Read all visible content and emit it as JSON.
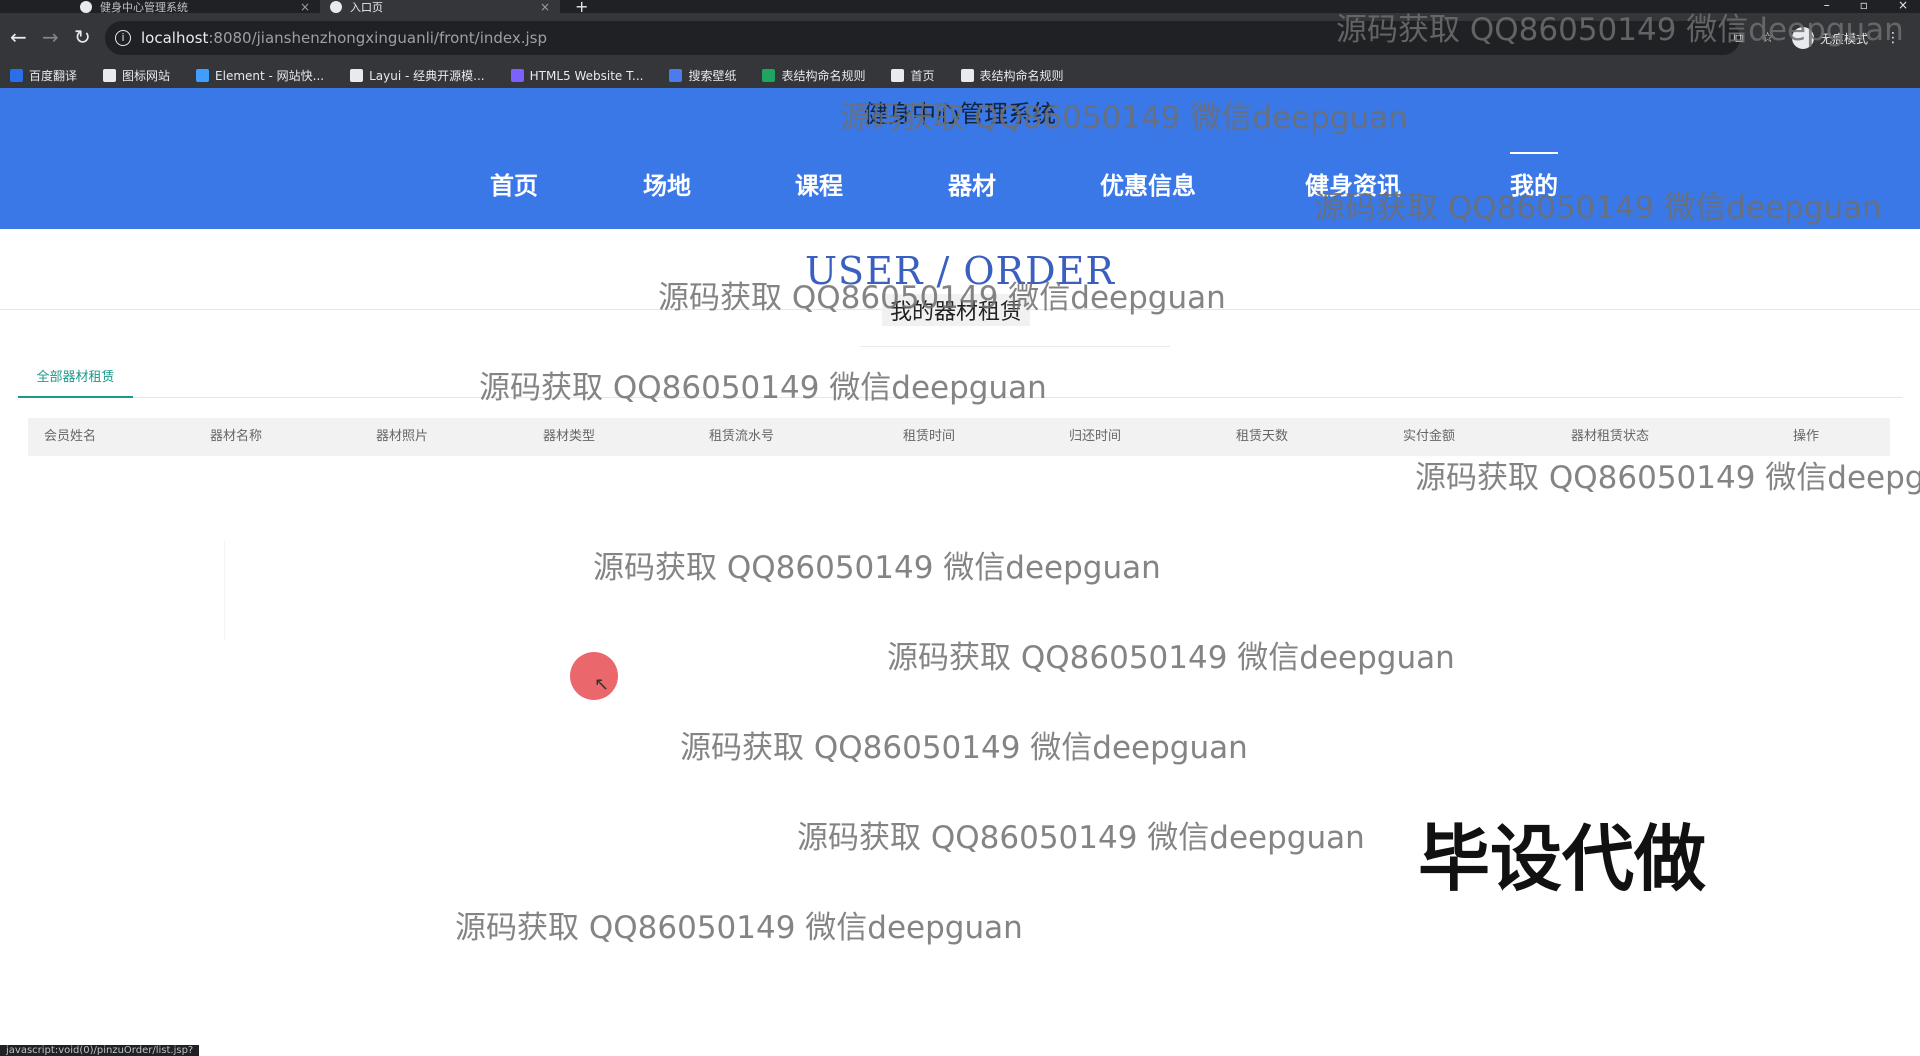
{
  "browser": {
    "tabs": [
      {
        "label": "健身中心管理系统"
      },
      {
        "label": "入口页"
      }
    ],
    "url": {
      "host": "localhost",
      "path": ":8080/jianshenzhongxinguanli/front/index.jsp"
    },
    "mode_label": "无痕模式",
    "bookmarks": [
      {
        "label": "百度翻译",
        "color": "#2a6fe8"
      },
      {
        "label": "图标网站",
        "color": "#e8eaed"
      },
      {
        "label": "Element - 网站快...",
        "color": "#409eff"
      },
      {
        "label": "Layui - 经典开源模...",
        "color": "#e8eaed"
      },
      {
        "label": "HTML5 Website T...",
        "color": "#7b61ff"
      },
      {
        "label": "搜索壁纸",
        "color": "#4a7cf0"
      },
      {
        "label": "表结构命名规则",
        "color": "#1fa463"
      },
      {
        "label": "首页",
        "color": "#e8eaed"
      },
      {
        "label": "表结构命名规则",
        "color": "#e8eaed"
      }
    ],
    "status_text": "javascript:void(0)/pinzuOrder/list.jsp?"
  },
  "site": {
    "title": "健身中心管理系统",
    "nav": [
      {
        "label": "首页"
      },
      {
        "label": "场地"
      },
      {
        "label": "课程"
      },
      {
        "label": "器材"
      },
      {
        "label": "优惠信息"
      },
      {
        "label": "健身资讯"
      },
      {
        "label": "我的"
      }
    ],
    "active_nav": "我的",
    "accent_color": "#3a78e8"
  },
  "section": {
    "en_title": "USER / ORDER",
    "cn_title": "我的器材租赁"
  },
  "tabs": {
    "all_label": "全部器材租赁"
  },
  "table": {
    "headers": [
      "会员姓名",
      "器材名称",
      "器材照片",
      "器材类型",
      "租赁流水号",
      "租赁时间",
      "归还时间",
      "租赁天数",
      "实付金额",
      "器材租赁状态",
      "操作"
    ],
    "rows": []
  },
  "overlays": {
    "watermark": "源码获取 QQ86050149 微信deepguan",
    "stamp": "毕设代做"
  }
}
